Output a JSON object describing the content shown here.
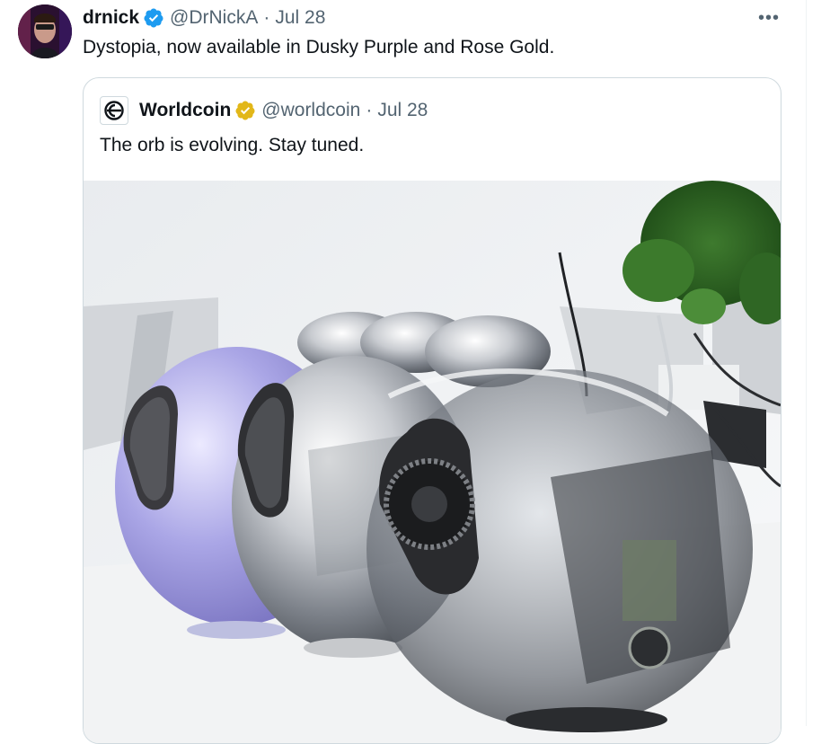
{
  "tweet": {
    "display_name": "drnick",
    "handle": "@DrNickA",
    "separator": "·",
    "date": "Jul 28",
    "text": "Dystopia, now available in Dusky Purple and Rose Gold.",
    "more_label": "•••"
  },
  "quoted": {
    "display_name": "Worldcoin",
    "handle": "@worldcoin",
    "separator": "·",
    "date": "Jul 28",
    "text": "The orb is evolving. Stay tuned."
  },
  "colors": {
    "verified_blue": "#1d9bf0",
    "verified_gold": "#e2b719",
    "muted_text": "#536471",
    "border": "#cfd9de"
  },
  "icons": {
    "avatar": "avatar",
    "verified": "verified-badge-icon",
    "gold_verified": "gold-verified-badge-icon",
    "more": "more-options-icon",
    "worldcoin_logo": "worldcoin-logo-icon"
  }
}
